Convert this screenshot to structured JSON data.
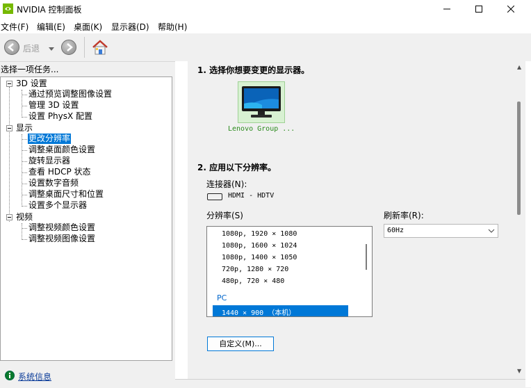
{
  "window": {
    "title": "NVIDIA 控制面板"
  },
  "menu": [
    "文件(F)",
    "编辑(E)",
    "桌面(K)",
    "显示器(D)",
    "帮助(H)"
  ],
  "toolbar": {
    "back_label": "后退"
  },
  "tasks": {
    "header": "选择一项任务...",
    "groups": [
      {
        "label": "3D 设置",
        "items": [
          "通过预览调整图像设置",
          "管理 3D 设置",
          "设置 PhysX 配置"
        ]
      },
      {
        "label": "显示",
        "items": [
          "更改分辨率",
          "调整桌面颜色设置",
          "旋转显示器",
          "查看 HDCP 状态",
          "设置数字音频",
          "调整桌面尺寸和位置",
          "设置多个显示器"
        ]
      },
      {
        "label": "视频",
        "items": [
          "调整视频颜色设置",
          "调整视频图像设置"
        ]
      }
    ],
    "selected": "更改分辨率"
  },
  "footer": {
    "sysinfo": "系统信息"
  },
  "main": {
    "step1": "1. 选择你想要变更的显示器。",
    "monitor_label": "Lenovo Group ...",
    "step2": "2. 应用以下分辨率。",
    "connector_label": "连接器(N):",
    "connector_value": "HDMI - HDTV",
    "resolution_label": "分辨率(S)",
    "resolutions": [
      "1080p, 1920 × 1080",
      "1080p, 1600 × 1024",
      "1080p, 1400 × 1050",
      "720p, 1280 × 720",
      "480p, 720 × 480"
    ],
    "resolution_group": "PC",
    "resolution_selected": "1440 × 900 （本机）",
    "refresh_label": "刷新率(R):",
    "refresh_value": "60Hz",
    "custom_button": "自定义(M)..."
  },
  "colors": {
    "selection": "#0078d7",
    "nvidia_green": "#76b900",
    "monitor_highlight": "#d8f1d2"
  },
  "icons": [
    "nvidia-icon",
    "back-arrow-icon",
    "forward-arrow-icon",
    "home-icon",
    "monitor-icon",
    "hdmi-connector-icon",
    "chevron-down-icon",
    "system-info-icon"
  ]
}
